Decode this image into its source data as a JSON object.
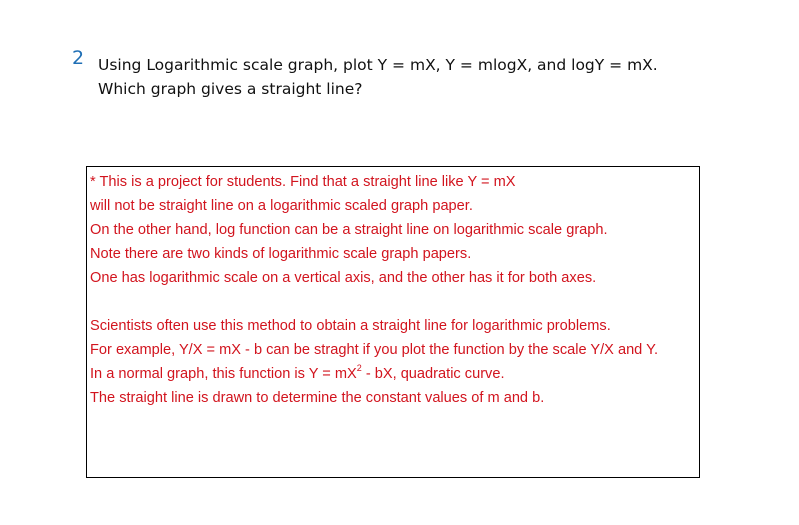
{
  "question": {
    "number": "2",
    "line1": "Using Logarithmic scale graph, plot Y = mX, Y = mlogX, and logY = mX.",
    "line2": "Which graph gives a straight line?"
  },
  "note": {
    "lines": [
      "* This is a project for students. Find that a straight line like Y = mX",
      "will not be straight line on a logarithmic scaled graph paper.",
      "On the other hand, log function can be a straight line on logarithmic scale graph.",
      "Note there are two kinds of logarithmic scale graph papers.",
      "One has logarithmic scale on a vertical axis, and the other has it for both axes.",
      "Scientists often use this method to obtain a straight line for logarithmic problems.",
      "For example, Y/X = mX - b can be straght if you plot the function by the scale Y/X and Y."
    ],
    "quadratic_line": {
      "prefix": "In a normal graph, this function is Y = mX",
      "superscript": "2",
      "suffix": " - bX, quadratic curve."
    },
    "last_line": "The straight line is drawn to determine the constant values of m and b."
  },
  "colors": {
    "question_number": "#1f6fb5",
    "question_text": "#111111",
    "note_text": "#d2141e",
    "box_border": "#000000"
  }
}
